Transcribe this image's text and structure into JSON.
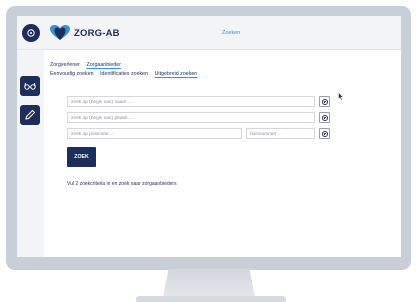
{
  "header": {
    "brand_name": "ZORG-AB",
    "title": "Zoeken",
    "brand_color": "#1d2d5c",
    "accent_color": "#3b8fd6",
    "logo_heart_color": "#3b8fd6"
  },
  "sidebar": {
    "items": [
      {
        "icon": "glasses-icon"
      },
      {
        "icon": "pencil-icon"
      }
    ]
  },
  "tabs": {
    "primary": [
      "Zorgverlener",
      "Zorgaanbieder"
    ],
    "primary_active": "Zorgaanbieder",
    "secondary": [
      "Eenvoudig zoeken",
      "Identificaties zoeken",
      "Uitgebreid zoeken"
    ],
    "secondary_active": "Uitgebreid zoeken"
  },
  "form": {
    "name_placeholder": "zoek op (begin van) naam ...",
    "place_placeholder": "zoek op (begin van) plaats ...",
    "postcode_placeholder": "zoek op postcode ...",
    "house_number_placeholder": "huisnummer ...",
    "search_button": "ZOEK"
  },
  "hint_text": "Vul 2 zoekcriteria in en zoek naar zorgaanbieders"
}
